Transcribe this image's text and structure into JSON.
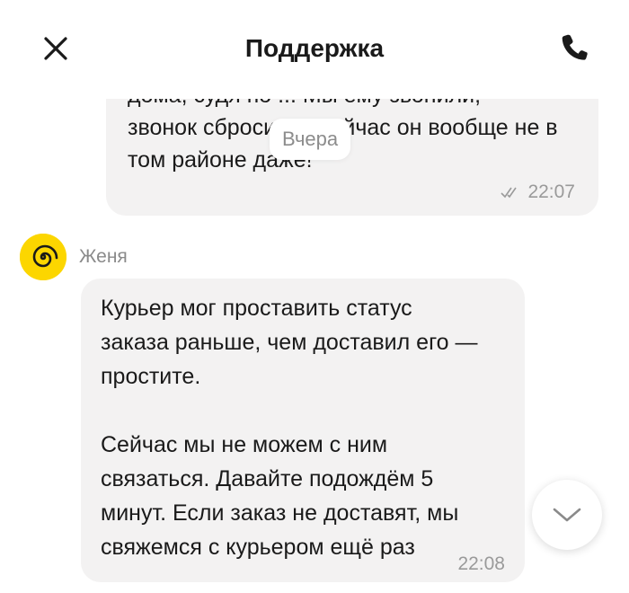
{
  "header": {
    "title": "Поддержка",
    "close_icon": "close-icon",
    "phone_icon": "phone-icon"
  },
  "messages": {
    "outgoing": {
      "text": "дома, судя по ... Мы ему звонили,\nзвонок сбросил... Сейчас он вообще не в\nтом районе даже!",
      "time": "22:07",
      "status_icon": "double-check-icon"
    },
    "date_separator": "Вчера",
    "incoming": {
      "sender": "Женя",
      "avatar_icon": "spiral-avatar-icon",
      "text": "Курьер мог проставить статус\nзаказа раньше, чем доставил его —\nпростите.\n\nСейчас мы не можем с ним\nсвязаться. Давайте подождём 5\nминут. Если заказ не доставят, мы\nсвяжемся с курьером ещё раз",
      "time": "22:08"
    }
  },
  "scroll_button_icon": "chevron-down-icon",
  "colors": {
    "bubble": "#f3f2f2",
    "avatar": "#fcd600",
    "meta_text": "#9a9a9a"
  }
}
